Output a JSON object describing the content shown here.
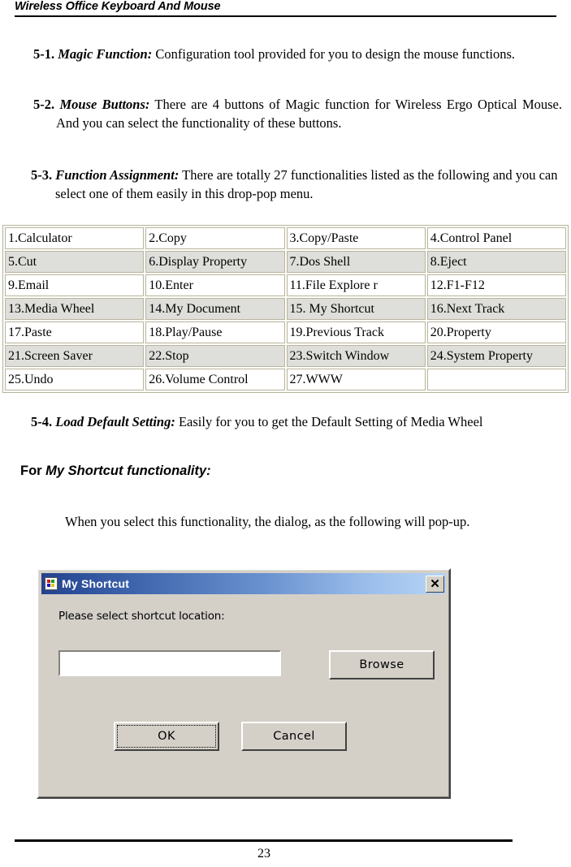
{
  "header": {
    "title": "Wireless Office Keyboard And Mouse"
  },
  "items": [
    {
      "number": "5-1.",
      "term": "Magic Function:",
      "body": " Configuration tool provided for you to design the mouse functions."
    },
    {
      "number": "5-2.",
      "term": "Mouse Buttons:",
      "body": " There are 4 buttons of Magic function for Wireless Ergo Optical Mouse. And you can select the functionality of these buttons."
    },
    {
      "number": "5-3.",
      "term": "Function Assignment:",
      "body": " There are totally 27 functionalities listed as the following and you can select one of them easily in this drop-pop menu."
    },
    {
      "number": "5-4.",
      "term": "Load Default Setting:",
      "body": " Easily for you to get the Default Setting of Media Wheel"
    }
  ],
  "function_table": {
    "rows": [
      [
        "1.Calculator",
        "2.Copy",
        "3.Copy/Paste",
        "4.Control Panel"
      ],
      [
        "5.Cut",
        "6.Display Property",
        "7.Dos Shell",
        "8.Eject"
      ],
      [
        "9.Email",
        "10.Enter",
        "11.File Explore r",
        "12.F1-F12"
      ],
      [
        "13.Media Wheel",
        "14.My Document",
        "15. My Shortcut",
        "16.Next Track"
      ],
      [
        "17.Paste",
        "18.Play/Pause",
        "19.Previous Track",
        "20.Property"
      ],
      [
        "21.Screen Saver",
        "22.Stop",
        "23.Switch Window",
        "24.System Property"
      ],
      [
        "25.Undo",
        "26.Volume Control",
        "27.WWW",
        ""
      ]
    ]
  },
  "subhead": {
    "prefix": "For ",
    "emphasis": "My Shortcut functionality:"
  },
  "paragraph": "When you select this functionality, the dialog, as the following will pop-up.",
  "dialog": {
    "title": "My Shortcut",
    "close_label": "✕",
    "prompt": "Please select shortcut location:",
    "input_value": "",
    "input_placeholder": "",
    "browse_label": "Browse",
    "ok_label": "OK",
    "cancel_label": "Cancel"
  },
  "footer": {
    "page_number": "23"
  },
  "colors": {
    "titlebar_start": "#23428f",
    "titlebar_end": "#b7d4f4",
    "dialog_face": "#d4d0c8",
    "table_shaded_row": "#dededa"
  }
}
